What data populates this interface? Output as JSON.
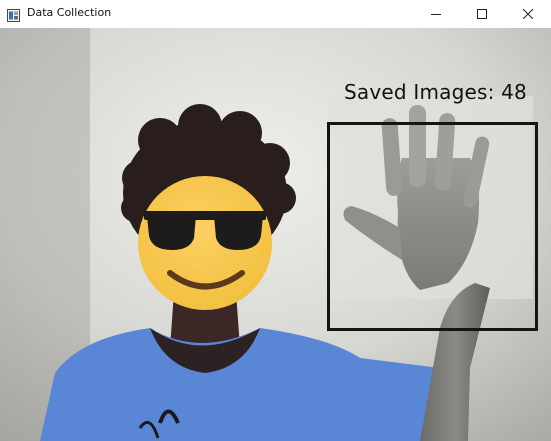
{
  "window": {
    "title": "Data Collection",
    "controls": {
      "minimize_icon": "minimize-icon",
      "maximize_icon": "maximize-icon",
      "close_icon": "close-icon"
    }
  },
  "camera_view": {
    "saved_images_label": "Saved Images:",
    "saved_images_count": "48",
    "roi_color": "#141414",
    "face_overlay": "sunglasses-emoji",
    "shirt_color": "#5a86d6"
  }
}
